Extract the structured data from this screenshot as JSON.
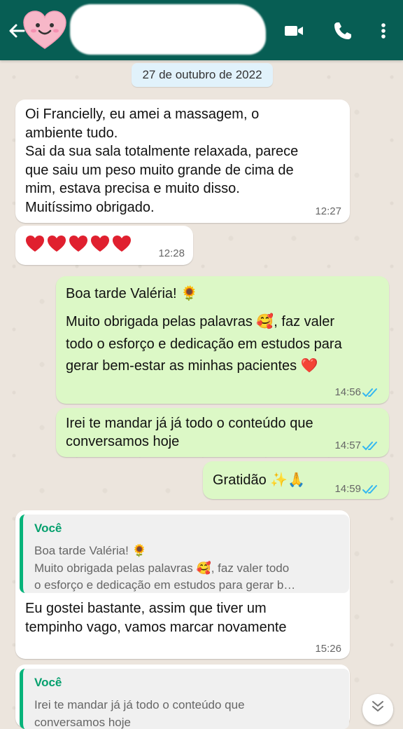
{
  "header": {
    "contact_name_obscured": "…",
    "icons": [
      "back-arrow-icon",
      "avatar-heart-face",
      "video-call-icon",
      "phone-icon",
      "more-icon"
    ],
    "colors": {
      "bar": "#075E54",
      "incoming": "#ffffff",
      "outgoing": "#DCF8C6",
      "reply_accent": "#06A06E",
      "read_ticks": "#34B7F1"
    }
  },
  "date_chip": "27 de outubro de 2022",
  "messages": {
    "m1": {
      "lines": [
        "Oi Francielly, eu amei a massagem, o",
        "ambiente tudo.",
        "Sai da sua sala totalmente relaxada, parece",
        "que saiu um peso muito grande de cima de",
        "mim, estava precisa e muito disso.",
        "Muitíssimo obrigado."
      ],
      "time": "12:27"
    },
    "m2": {
      "hearts": 5,
      "time": "12:28"
    },
    "m3": {
      "line1": "Boa tarde Valéria! 🌻",
      "line2": "Muito obrigada pelas palavras 🥰, faz valer",
      "line3": "todo o esforço e dedicação em estudos para",
      "line4": "gerar bem-estar as minhas pacientes ❤️",
      "time": "14:56"
    },
    "m4": {
      "line1": "Irei te mandar já já todo o conteúdo que",
      "line2": "conversamos hoje",
      "time": "14:57"
    },
    "m5": {
      "text": "Gratidão ✨🙏",
      "time": "14:59"
    },
    "m6": {
      "quote_author": "Você",
      "quote_line1": "Boa tarde Valéria! 🌻",
      "quote_line2": "Muito obrigada pelas palavras 🥰, faz valer todo",
      "quote_line3": "o esforço e dedicação em estudos para gerar b…",
      "line1": "Eu gostei bastante, assim que tiver um",
      "line2": "tempinho vago, vamos marcar novamente",
      "time": "15:26"
    },
    "m7": {
      "quote_author": "Você",
      "quote_line1": "Irei te mandar já já todo o conteúdo que",
      "quote_line2": "conversamos hoje"
    }
  }
}
